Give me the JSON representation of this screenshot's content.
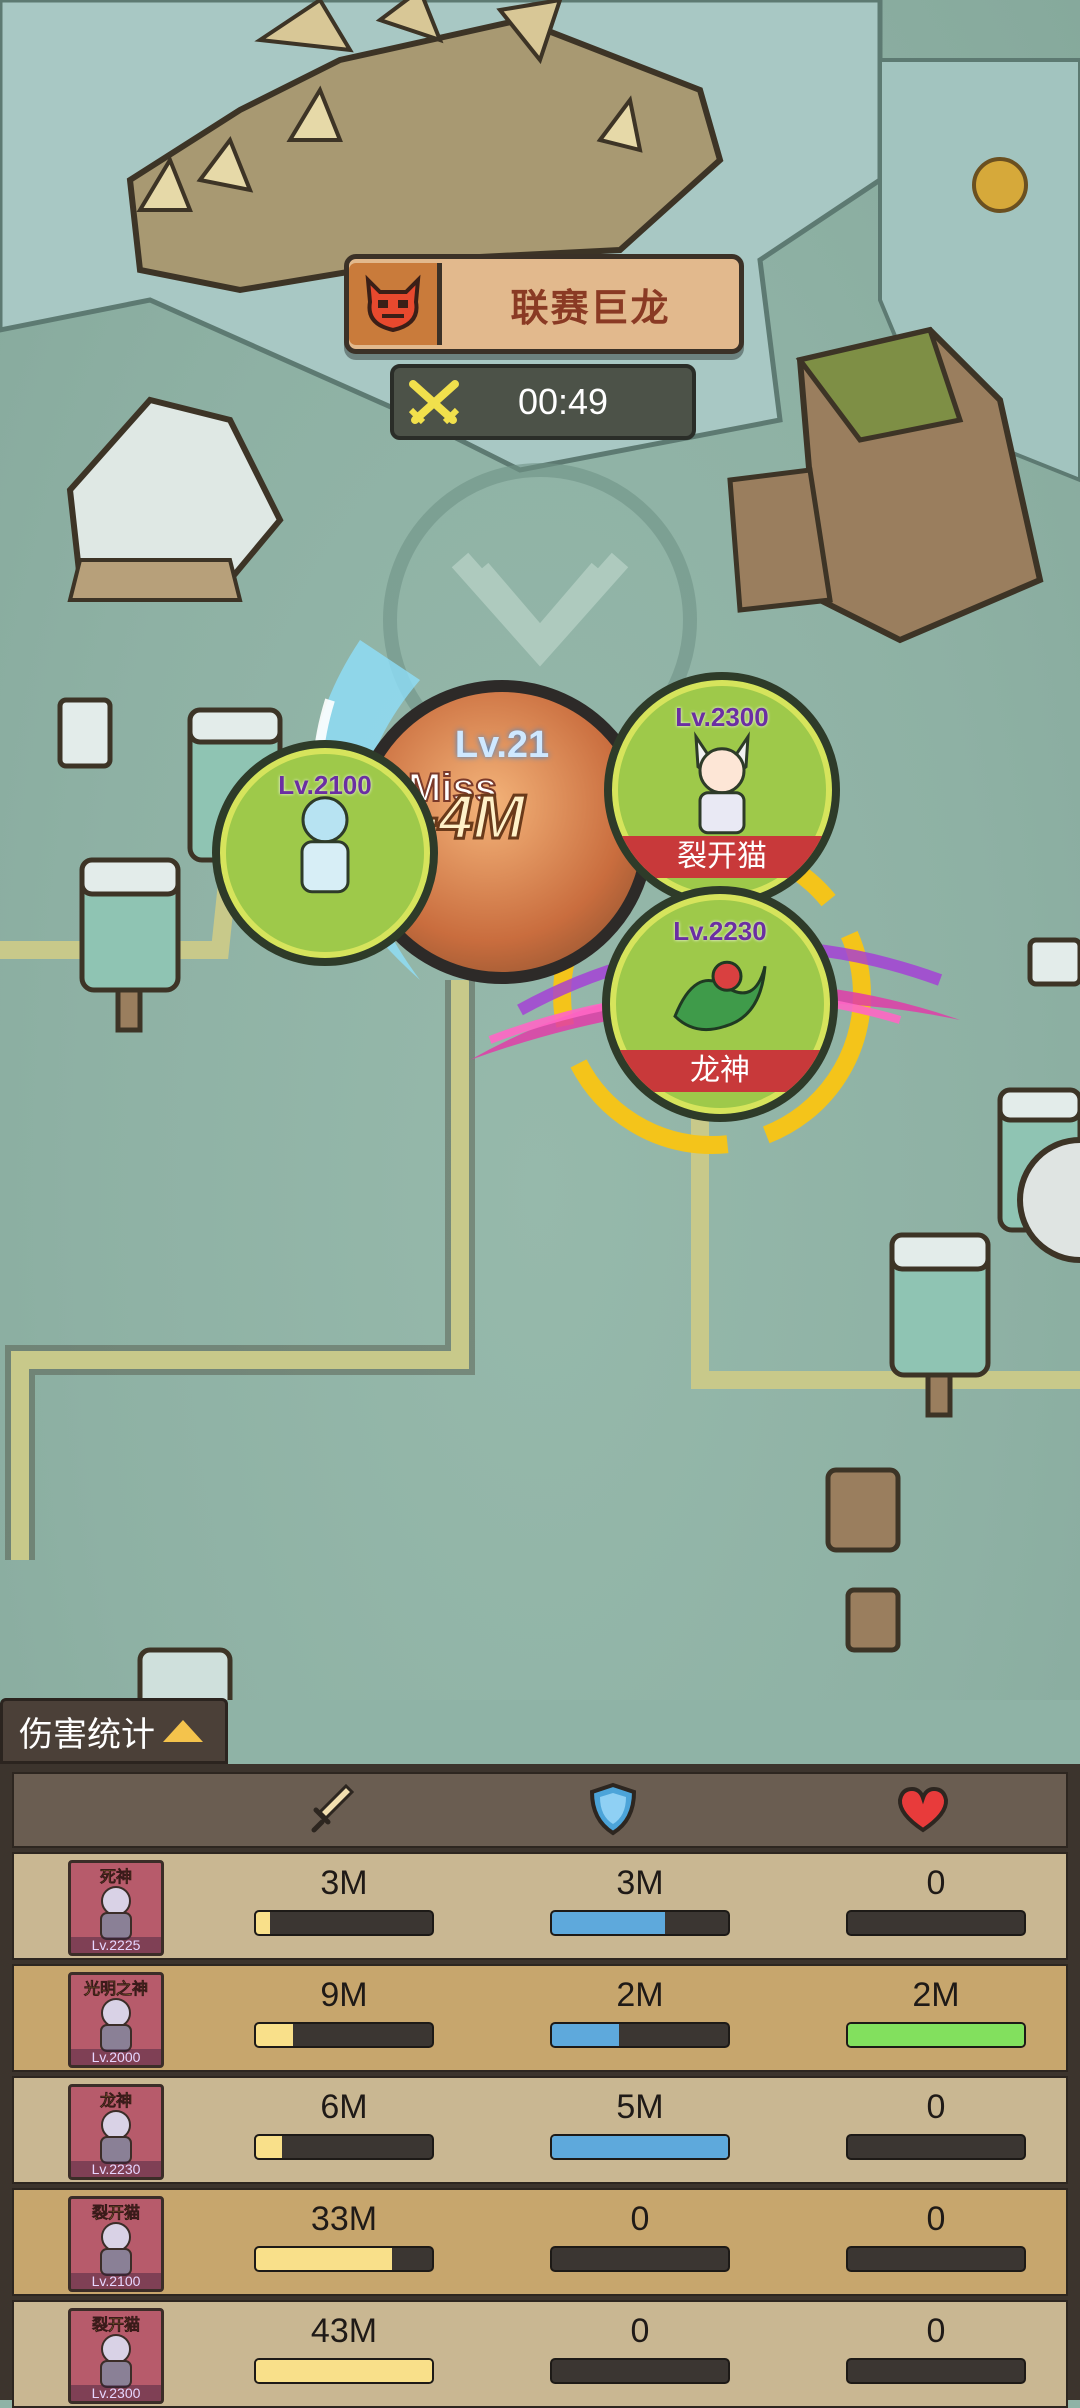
{
  "boss": {
    "name": "联赛巨龙"
  },
  "timer": {
    "value": "00:49"
  },
  "enemy": {
    "level": "Lv.21",
    "miss_text": "Miss",
    "damage_text": "-4M"
  },
  "heroes": [
    {
      "level": "Lv.2100",
      "name": ""
    },
    {
      "level": "Lv.2300",
      "name": "裂开猫"
    },
    {
      "level": "Lv.2230",
      "name": "龙神"
    }
  ],
  "stats": {
    "tab_label": "伤害统计",
    "header_icons": [
      "sword-icon",
      "shield-icon",
      "heart-icon"
    ],
    "rows": [
      {
        "name": "死神",
        "level": "Lv.2225",
        "attack": "3M",
        "attack_pct": 0.08,
        "defense": "3M",
        "defense_pct": 0.64,
        "heal": "0",
        "heal_pct": 0
      },
      {
        "name": "光明之神",
        "level": "Lv.2000",
        "attack": "9M",
        "attack_pct": 0.21,
        "defense": "2M",
        "defense_pct": 0.38,
        "heal": "2M",
        "heal_pct": 1.0
      },
      {
        "name": "龙神",
        "level": "Lv.2230",
        "attack": "6M",
        "attack_pct": 0.15,
        "defense": "5M",
        "defense_pct": 1.0,
        "heal": "0",
        "heal_pct": 0
      },
      {
        "name": "裂开猫",
        "level": "Lv.2100",
        "attack": "33M",
        "attack_pct": 0.77,
        "defense": "0",
        "defense_pct": 0,
        "heal": "0",
        "heal_pct": 0
      },
      {
        "name": "裂开猫",
        "level": "Lv.2300",
        "attack": "43M",
        "attack_pct": 1.0,
        "defense": "0",
        "defense_pct": 0,
        "heal": "0",
        "heal_pct": 0
      }
    ]
  },
  "colors": {
    "attack": "#f9e08a",
    "defense": "#5ea9dc",
    "heal": "#82e05e",
    "hero_tag": "#c8393a"
  }
}
